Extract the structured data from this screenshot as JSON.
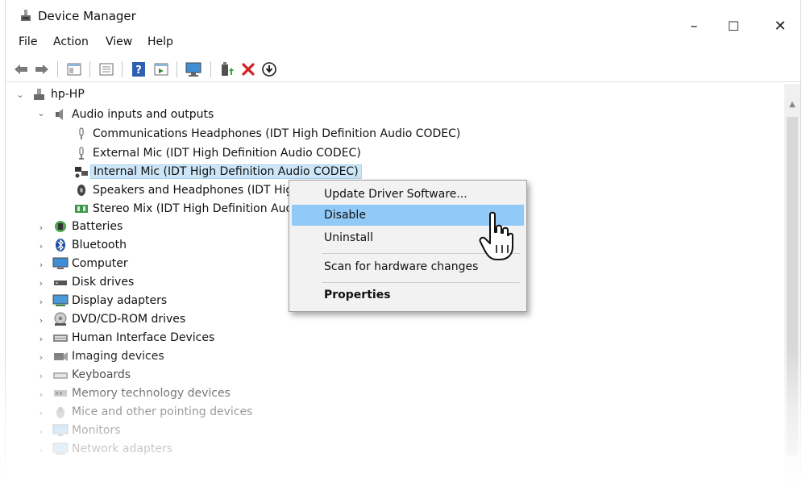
{
  "window": {
    "title": "Device Manager",
    "controls": {
      "minimize": "–",
      "maximize": "☐",
      "close": "✕"
    }
  },
  "menu": [
    "File",
    "Action",
    "View",
    "Help"
  ],
  "toolbar": {
    "buttons": [
      "back-arrow-icon",
      "forward-arrow-icon",
      "properties-panel-icon",
      "console-tree-icon",
      "help-icon",
      "view-icon",
      "monitor-icon",
      "update-driver-icon",
      "uninstall-icon",
      "download-icon"
    ]
  },
  "tree": {
    "root": "hp-HP",
    "audio_group": "Audio inputs and outputs",
    "audio_children": [
      "Communications Headphones (IDT High Definition Audio CODEC)",
      "External Mic (IDT High Definition Audio CODEC)",
      "Internal Mic (IDT High Definition Audio CODEC)",
      "Speakers and Headphones (IDT High",
      "Stereo Mix (IDT High Definition Audio"
    ],
    "categories": [
      "Batteries",
      "Bluetooth",
      "Computer",
      "Disk drives",
      "Display adapters",
      "DVD/CD-ROM drives",
      "Human Interface Devices",
      "Imaging devices",
      "Keyboards",
      "Memory technology devices",
      "Mice and other pointing devices",
      "Monitors",
      "Network adapters"
    ]
  },
  "context_menu": {
    "items": [
      "Update Driver Software...",
      "Disable",
      "Uninstall",
      "Scan for hardware changes",
      "Properties"
    ],
    "highlighted": "Disable"
  },
  "colors": {
    "selection": "#cde6f7",
    "menu_highlight": "#91c9f7",
    "remove_red": "#d42020"
  }
}
